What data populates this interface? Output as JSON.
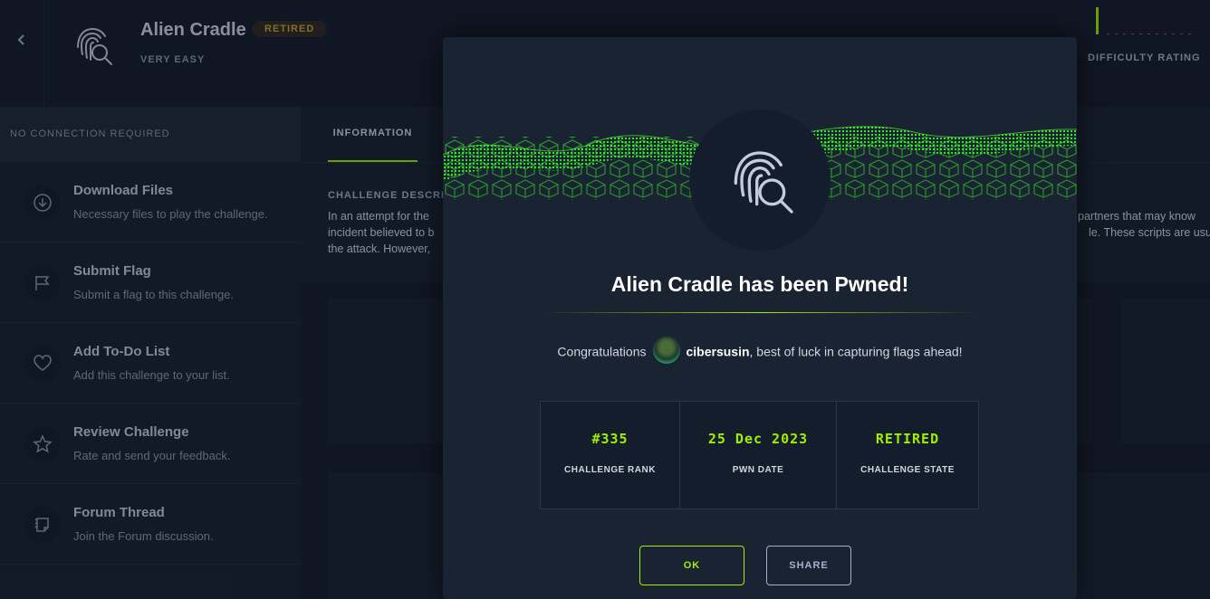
{
  "header": {
    "back_label": "‹",
    "challenge_name": "Alien Cradle",
    "status_badge": "RETIRED",
    "difficulty": "VERY EASY",
    "difficulty_rating_label": "DIFFICULTY RATING"
  },
  "sidebar": {
    "connection_label": "NO CONNECTION REQUIRED",
    "items": [
      {
        "title": "Download Files",
        "description": "Necessary files to play the challenge.",
        "icon": "download-icon"
      },
      {
        "title": "Submit Flag",
        "description": "Submit a flag to this challenge.",
        "icon": "flag-icon"
      },
      {
        "title": "Add To-Do List",
        "description": "Add this challenge to your list.",
        "icon": "heart-icon"
      },
      {
        "title": "Review Challenge",
        "description": "Rate and send your feedback.",
        "icon": "star-icon"
      },
      {
        "title": "Forum Thread",
        "description": "Join the Forum discussion.",
        "icon": "forum-icon"
      }
    ]
  },
  "main": {
    "tab_information": "INFORMATION",
    "description_label": "CHALLENGE DESCRIPT",
    "description_left": [
      "In an attempt for the",
      "incident believed to b",
      "the attack. However,"
    ],
    "description_right": [
      "partners that may know",
      "le. These scripts are usua"
    ]
  },
  "modal": {
    "title": "Alien Cradle has been Pwned!",
    "congrats_prefix": "Congratulations",
    "username": "cibersusin",
    "congrats_suffix": ", best of luck in capturing flags ahead!",
    "stats": [
      {
        "value": "#335",
        "label": "CHALLENGE RANK"
      },
      {
        "value": "25 Dec 2023",
        "label": "PWN DATE"
      },
      {
        "value": "RETIRED",
        "label": "CHALLENGE STATE"
      }
    ],
    "ok_label": "OK",
    "share_label": "SHARE"
  },
  "colors": {
    "accent_green": "#9fef00",
    "retired_badge": "#c99f3b",
    "background": "#141d2b",
    "panel": "#1a2332"
  }
}
